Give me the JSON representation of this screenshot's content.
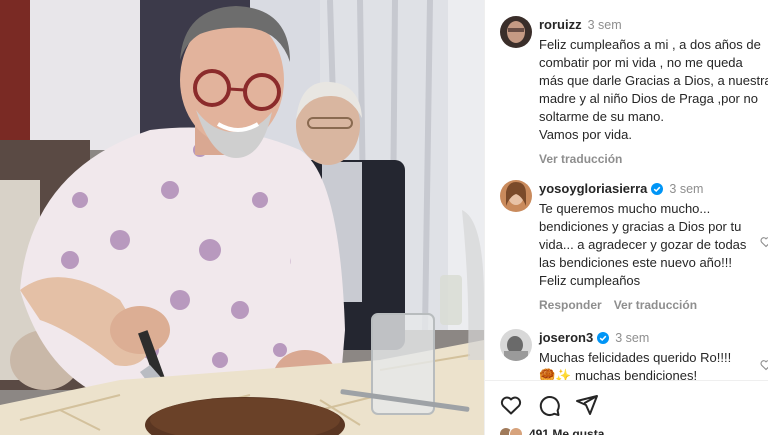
{
  "comments": [
    {
      "username": "roruizz",
      "time": "3 sem",
      "verified": false,
      "lines": [
        "Feliz cumpleaños a mi , a dos años de",
        "combatir por mi vida , no me queda",
        "más que darle Gracias a Dios, a nuestra",
        "madre y al niño Dios de Praga ,por no",
        "soltarme de su mano.",
        "Vamos por vida."
      ],
      "see_translation": "Ver traducción"
    },
    {
      "username": "yosoygloriasierra",
      "time": "3 sem",
      "verified": true,
      "lines": [
        "Te queremos mucho mucho...",
        "bendiciones y gracias a Dios por tu",
        "vida... a agradecer y gozar de todas",
        "las bendiciones este nuevo año!!!",
        "Feliz cumpleaños"
      ],
      "reply": "Responder",
      "see_translation": "Ver traducción"
    },
    {
      "username": "joseron3",
      "time": "3 sem",
      "verified": true,
      "lines": [
        "Muchas felicidades querido Ro!!!!",
        "🥮✨ muchas bendiciones!"
      ]
    }
  ],
  "footer": {
    "likes": "491 Me gusta"
  },
  "colors": {
    "verified": "#0095f6",
    "muted": "#8e8e8e",
    "text": "#262626"
  },
  "icons": [
    "heart-icon",
    "comment-icon",
    "share-icon",
    "verified-icon"
  ]
}
